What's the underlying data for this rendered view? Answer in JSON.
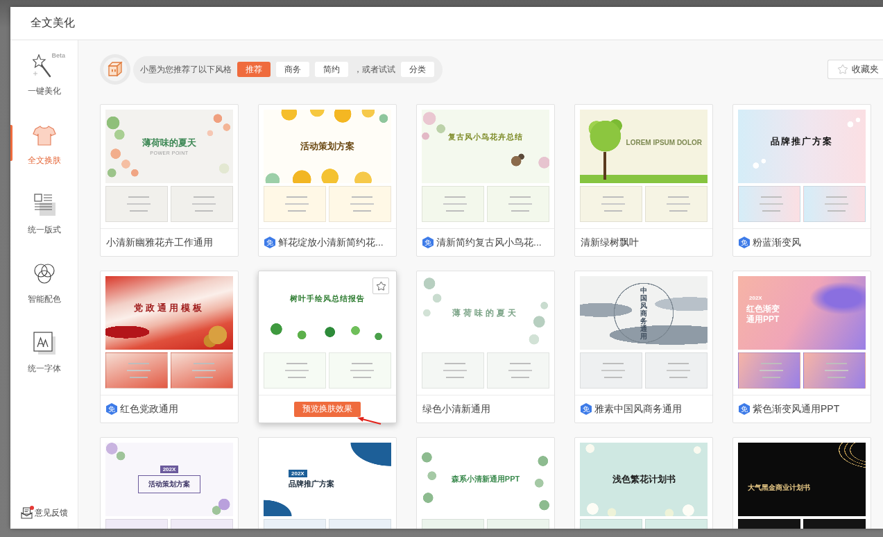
{
  "dialog": {
    "title": "全文美化"
  },
  "sidebar": {
    "items": [
      {
        "label": "一键美化",
        "badge": "Beta",
        "selected": false
      },
      {
        "label": "全文换肤",
        "selected": true
      },
      {
        "label": "统一版式",
        "selected": false
      },
      {
        "label": "智能配色",
        "selected": false
      },
      {
        "label": "统一字体",
        "selected": false
      }
    ],
    "feedback": {
      "label": "意见反馈",
      "unread": true
    }
  },
  "recommend_bar": {
    "message": "小墨为您推荐了以下风格",
    "styles": [
      {
        "label": "推荐",
        "selected": true
      },
      {
        "label": "商务",
        "selected": false
      },
      {
        "label": "简约",
        "selected": false
      }
    ],
    "alternative_text": "，或者试试",
    "category_button": "分类"
  },
  "favorites_button": "收藏夹",
  "templates": [
    {
      "title": "小清新幽雅花卉工作通用",
      "preview": {
        "title": "薄荷味的夏天",
        "subtitle": "POWER POINT"
      },
      "hovered": false
    },
    {
      "title": "鲜花绽放小清新简约花...",
      "badge": "免",
      "preview": {
        "title": "活动策划方案"
      },
      "hovered": false
    },
    {
      "title": "清新简约复古风小鸟花...",
      "badge": "免",
      "preview": {
        "title": "复古风小鸟花卉总结"
      },
      "hovered": false
    },
    {
      "title": "清新绿树飘叶",
      "preview": {
        "title": "LOREM IPSUM DOLOR"
      },
      "hovered": false
    },
    {
      "title": "粉蓝渐变风",
      "badge": "免",
      "preview": {
        "title": "品牌推广方案"
      },
      "hovered": false
    },
    {
      "title": "红色党政通用",
      "badge": "免",
      "preview": {
        "title": "党政通用模板"
      },
      "hovered": false
    },
    {
      "button": "预览换肤效果",
      "preview": {
        "title": "树叶手绘风总结报告"
      },
      "hovered": true
    },
    {
      "title": "绿色小清新通用",
      "preview": {
        "title": "薄荷味的夏天"
      },
      "hovered": false
    },
    {
      "title": "雅素中国风商务通用",
      "badge": "免",
      "preview": {
        "title": "中国风商务通用"
      },
      "hovered": false
    },
    {
      "title": "紫色渐变风通用PPT",
      "badge": "免",
      "preview": {
        "tag": "202X",
        "title": "红色渐变通用PPT"
      },
      "hovered": false
    },
    {
      "preview": {
        "tag": "202X",
        "title": "活动策划方案"
      },
      "hovered": false
    },
    {
      "preview": {
        "tag": "202X",
        "title": "品牌推广方案"
      },
      "hovered": false
    },
    {
      "preview": {
        "title": "森系小清新通用PPT"
      },
      "hovered": false
    },
    {
      "preview": {
        "title": "浅色繁花计划书"
      },
      "hovered": false
    },
    {
      "preview": {
        "title": "大气黑金商业计划书"
      },
      "hovered": false
    }
  ]
}
